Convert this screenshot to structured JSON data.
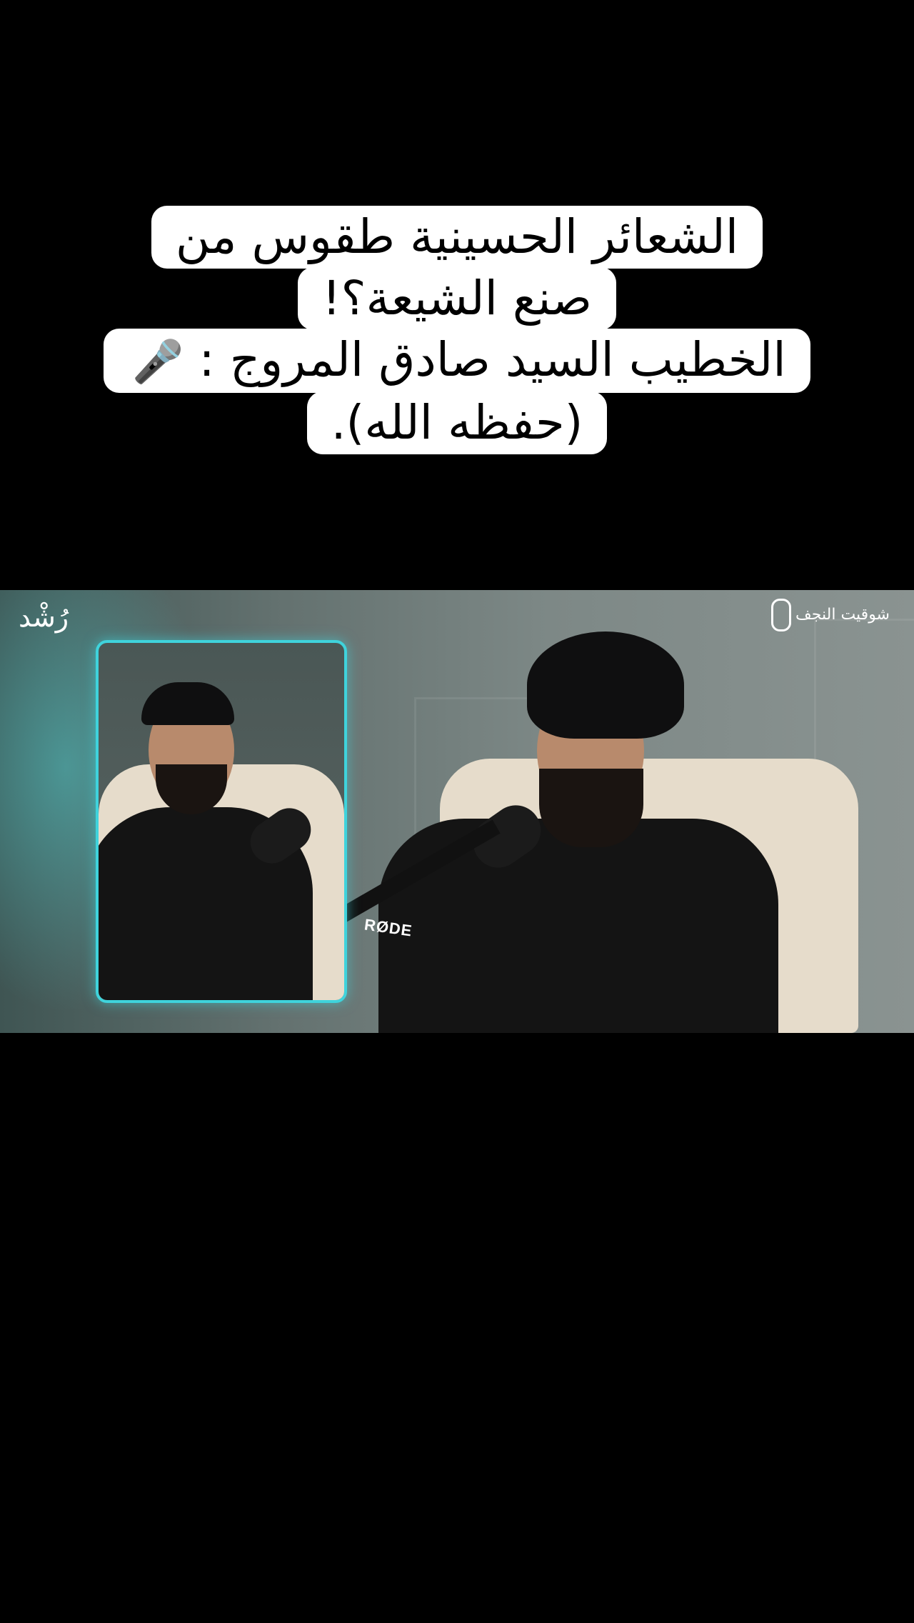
{
  "caption": {
    "lines": [
      "الشعائر الحسينية طقوس من",
      "صنع الشيعة؟!",
      "الخطيب السيد صادق المروج :",
      "(حفظه الله)."
    ],
    "mic_icon": "🎤"
  },
  "video": {
    "logo_left": "رُشْد",
    "logo_right": "شوقيت النجف",
    "mic_brand": "RØDE"
  }
}
